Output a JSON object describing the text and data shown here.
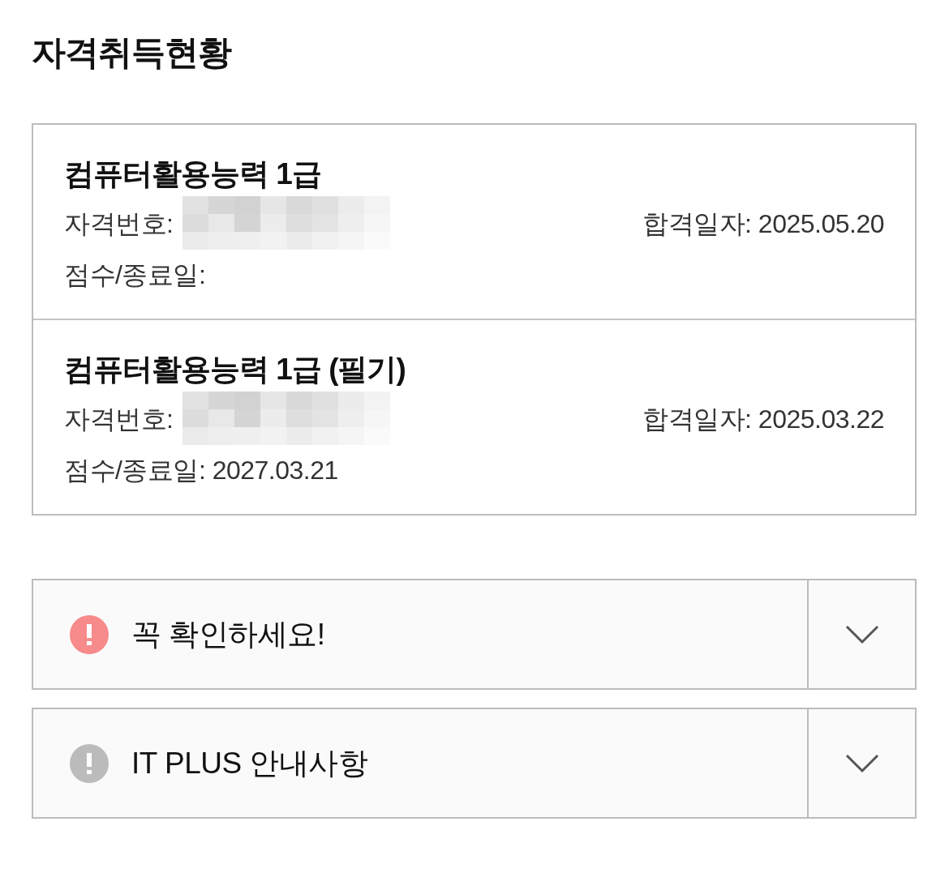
{
  "page": {
    "title": "자격취득현황"
  },
  "certificates": [
    {
      "name": "컴퓨터활용능력 1급",
      "number_label": "자격번호:",
      "number_redacted": true,
      "score": "점수/종료일:",
      "pass_date": "합격일자: 2025.05.20"
    },
    {
      "name": "컴퓨터활용능력 1급 (필기)",
      "number_label": "자격번호:",
      "number_redacted": true,
      "score": "점수/종료일: 2027.03.21",
      "pass_date": "합격일자: 2025.03.22"
    }
  ],
  "notices": [
    {
      "title": "꼭 확인하세요!",
      "color": "#f78a8a",
      "expanded": false
    },
    {
      "title": "IT PLUS 안내사항",
      "color": "#bbbbbb",
      "expanded": false
    }
  ]
}
